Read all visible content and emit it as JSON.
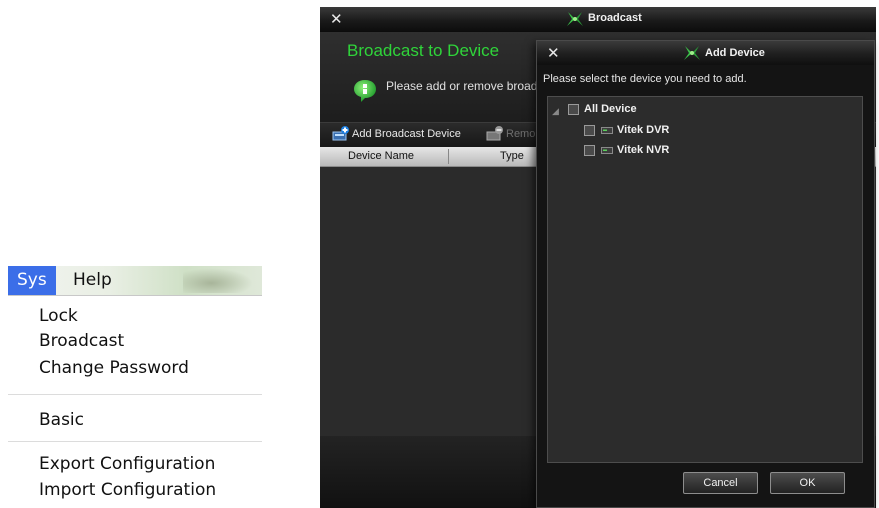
{
  "mac_menu": {
    "menubar": {
      "active_title": "Sys",
      "help_title": "Help"
    },
    "items": {
      "lock": "Lock",
      "broadcast": "Broadcast",
      "change_password": "Change Password",
      "basic": "Basic",
      "export": "Export Configuration",
      "import": "Import Configuration"
    }
  },
  "broadcast_window": {
    "title": "Broadcast",
    "heading": "Broadcast to Device",
    "info": "Please add or remove broad",
    "toolbar": {
      "add_label": "Add Broadcast Device",
      "remove_label": "Remo"
    },
    "table": {
      "columns": [
        "Device Name",
        "Type"
      ]
    }
  },
  "add_device_dialog": {
    "title": "Add Device",
    "prompt": "Please select the device you need to add.",
    "tree": {
      "root": {
        "label": "All Device",
        "checked": false,
        "expanded": true
      },
      "children": [
        {
          "label": "Vitek DVR",
          "checked": false
        },
        {
          "label": "Vitek NVR",
          "checked": false
        }
      ]
    },
    "buttons": {
      "cancel": "Cancel",
      "ok": "OK"
    }
  },
  "colors": {
    "heading_green": "#2fd43a",
    "menu_highlight": "#3b6ee8",
    "window_bg": "#262626"
  }
}
